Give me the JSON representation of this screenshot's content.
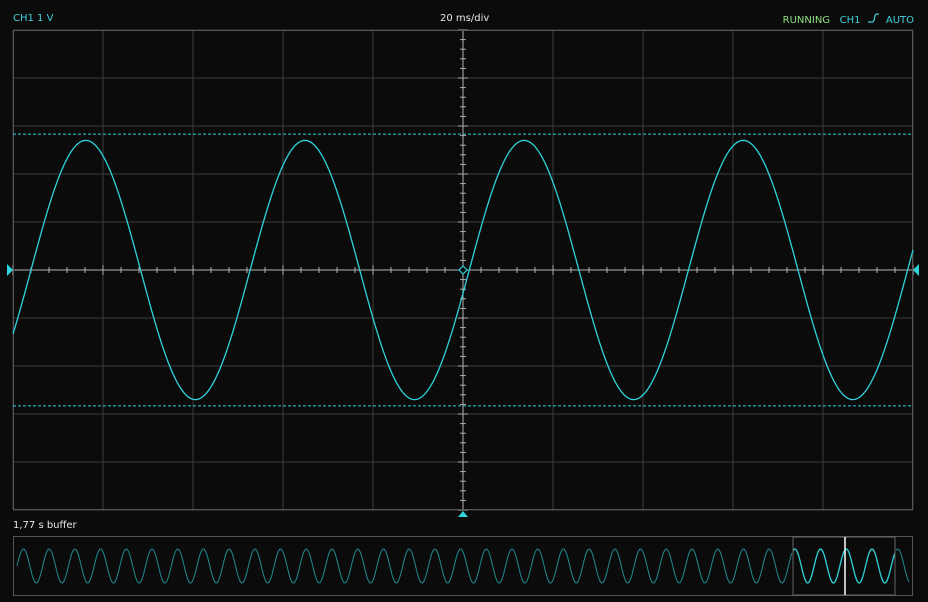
{
  "header": {
    "channel_label": "CH1 1 V",
    "timebase": "20 ms/div",
    "run_state": "RUNNING",
    "trigger_channel": "CH1",
    "trigger_edge_icon": "rising-edge-icon",
    "trigger_mode": "AUTO"
  },
  "buffer": {
    "label": "1,77 s buffer"
  },
  "colors": {
    "trace": "#2fd3dc",
    "grid": "#3e3e3e",
    "axis": "#b0b0b0",
    "running": "#8ee080",
    "background": "#0b0b0b"
  },
  "trace": {
    "volts_per_div": 1,
    "ms_per_div": 20,
    "amplitude_v": 2.7,
    "period_ms": 48.7,
    "phase_at_left_ms": -4,
    "offset_v": 0
  },
  "cursors": {
    "upper_v": 2.83,
    "lower_v": -2.83
  }
}
